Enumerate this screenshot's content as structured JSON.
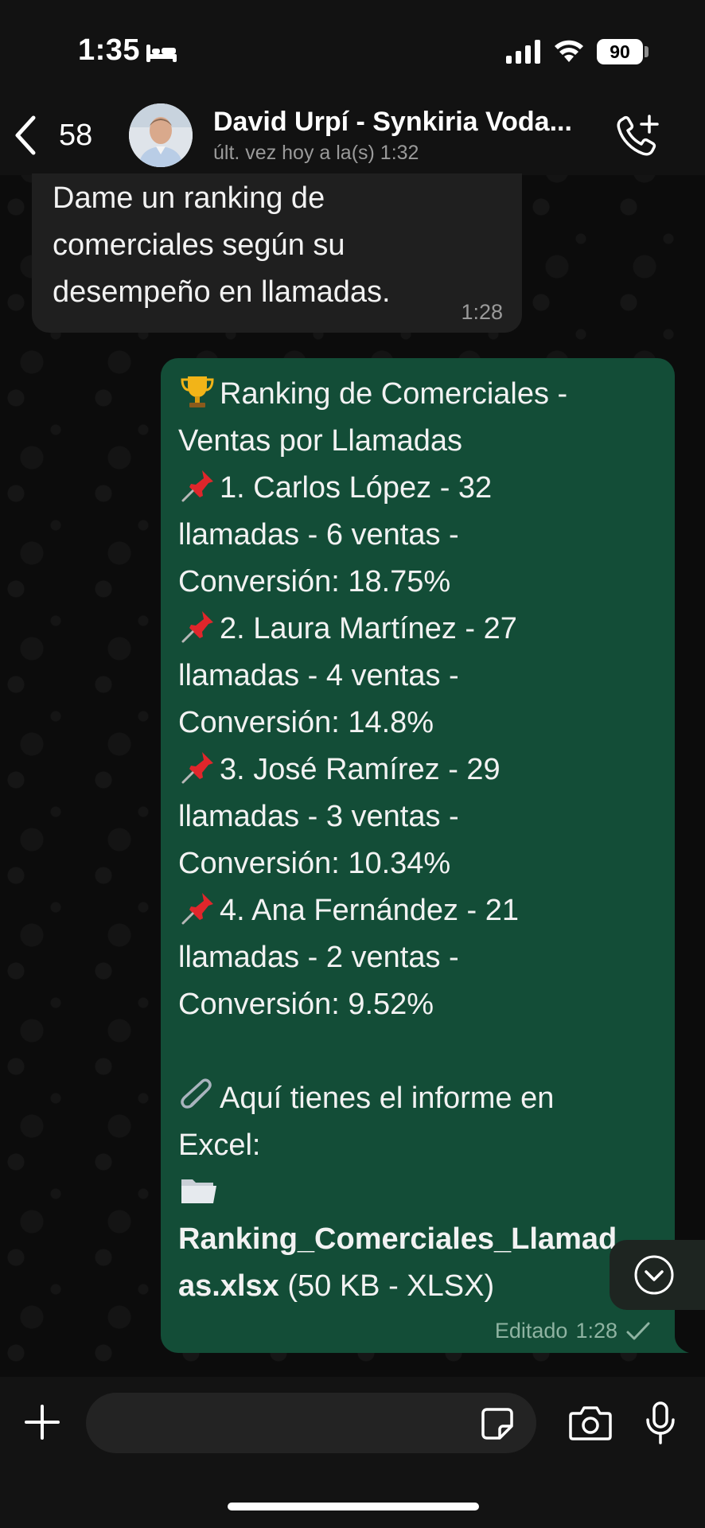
{
  "status": {
    "time": "1:35",
    "battery": "90",
    "icons": [
      "bed-icon",
      "signal-icon",
      "wifi-icon",
      "battery-icon"
    ]
  },
  "header": {
    "back_count": "58",
    "contact_name": "David Urpí - Synkiria Voda...",
    "last_seen": "últ. vez hoy a la(s) 1:32",
    "icons": [
      "chevron-left-icon",
      "avatar",
      "phone-plus-icon"
    ]
  },
  "incoming": {
    "text": "Dame un ranking de\ncomerciales según su\ndesempeño en llamadas.",
    "time": "1:28"
  },
  "outgoing": {
    "lines": [
      {
        "icon": "trophy",
        "text": "Ranking de Comerciales -"
      },
      {
        "text": "Ventas por Llamadas"
      },
      {
        "icon": "pin",
        "text": "1. Carlos López - 32"
      },
      {
        "text": "llamadas - 6 ventas -"
      },
      {
        "text": "Conversión: 18.75%"
      },
      {
        "icon": "pin",
        "text": "2. Laura Martínez - 27"
      },
      {
        "text": "llamadas - 4 ventas -"
      },
      {
        "text": "Conversión: 14.8%"
      },
      {
        "icon": "pin",
        "text": "3. José Ramírez - 29"
      },
      {
        "text": "llamadas - 3 ventas -"
      },
      {
        "text": "Conversión: 10.34%"
      },
      {
        "icon": "pin",
        "text": "4. Ana Fernández - 21"
      },
      {
        "text": "llamadas - 2 ventas -"
      },
      {
        "text": "Conversión: 9.52%"
      }
    ],
    "attachment_intro_1": "Aquí tienes el informe en",
    "attachment_intro_2": "Excel:",
    "file_name_1": "Ranking_Comerciales_Llamad",
    "file_name_2": "as.xlsx",
    "file_info": " (50 KB - XLSX)",
    "edited_label": "Editado",
    "time": "1:28"
  },
  "input": {
    "placeholder": ""
  },
  "colors": {
    "outgoing_bubble": "#134d37",
    "incoming_bubble": "#1f1f1f",
    "background": "#0c0c0c"
  }
}
